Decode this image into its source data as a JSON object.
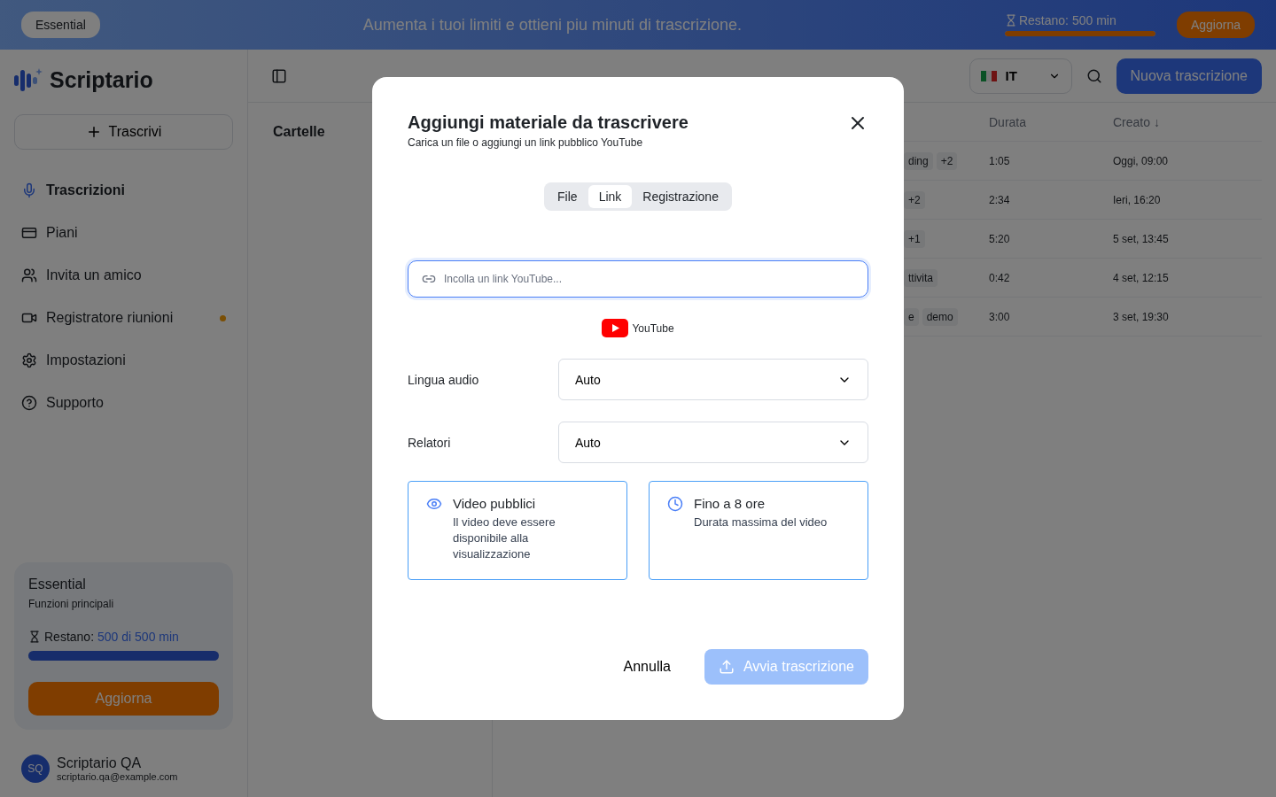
{
  "banner": {
    "plan": "Essential",
    "message": "Aumenta i tuoi limiti e ottieni piu minuti di trascrizione.",
    "remaining": {
      "label": "Restano:",
      "value": "500 min",
      "level": 1
    },
    "upgrade": "Aggiorna"
  },
  "sidebar": {
    "brand": "Scriptario",
    "new_button": "Trascrivi",
    "items": [
      {
        "label": "Trascrizioni",
        "selected": true,
        "dot": false
      },
      {
        "label": "Piani",
        "selected": false,
        "dot": false
      },
      {
        "label": "Invita un amico",
        "selected": false,
        "dot": false
      },
      {
        "label": "Registratore riunioni",
        "selected": false,
        "dot": true
      },
      {
        "label": "Impostazioni",
        "selected": false,
        "dot": false
      },
      {
        "label": "Supporto",
        "selected": false,
        "dot": false
      }
    ],
    "plan_card": {
      "name": "Essential",
      "subtitle": "Funzioni principali",
      "remaining_label": "Restano:",
      "remaining_value": "500 di 500 min",
      "level": 1,
      "button": "Aggiorna"
    },
    "user": {
      "initials": "SQ",
      "name": "Scriptario QA",
      "email": "scriptario.qa@example.com"
    }
  },
  "toolbar": {
    "language": "IT",
    "new_button": "Nuova trascrizione"
  },
  "folders": {
    "title": "Cartelle"
  },
  "table": {
    "columns": [
      "Durata",
      "Creato ↓"
    ],
    "rows": [
      {
        "tags": [
          "ding",
          "+2"
        ],
        "duration": "1:05",
        "created": "Oggi, 09:00"
      },
      {
        "tags": [
          "+2"
        ],
        "duration": "2:34",
        "created": "Ieri, 16:20"
      },
      {
        "tags": [
          "+1"
        ],
        "duration": "5:20",
        "created": "5 set, 13:45"
      },
      {
        "tags": [
          "ttivita"
        ],
        "duration": "0:42",
        "created": "4 set, 12:15"
      },
      {
        "tags": [
          "e",
          "demo"
        ],
        "duration": "3:00",
        "created": "3 set, 19:30"
      }
    ]
  },
  "dialog": {
    "title": "Aggiungi materiale da trascrivere",
    "subtitle": "Carica un file o aggiungi un link pubblico YouTube",
    "tabs": [
      {
        "label": "File",
        "selected": false
      },
      {
        "label": "Link",
        "selected": true
      },
      {
        "label": "Registrazione",
        "selected": false
      }
    ],
    "link_field": {
      "placeholder": "Incolla un link YouTube..."
    },
    "source": "YouTube",
    "fields": [
      {
        "label": "Lingua audio",
        "value": "Auto"
      },
      {
        "label": "Relatori",
        "value": "Auto"
      }
    ],
    "info_cards": [
      {
        "title": "Video pubblici",
        "text": "Il video deve essere disponibile alla visualizzazione"
      },
      {
        "title": "Fino a 8 ore",
        "text": "Durata massima del video"
      }
    ],
    "cancel": "Annulla",
    "submit": {
      "label": "Avvia trascrizione",
      "disabled": true
    }
  }
}
